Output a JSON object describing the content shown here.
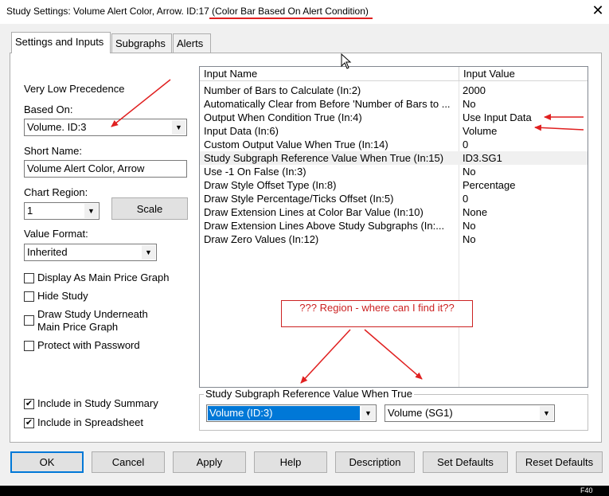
{
  "window": {
    "title_prefix": "Study Settings: Volume Alert Color, Arrow. ID:17 ",
    "title_highlight": "(Color Bar Based On Alert Condition)",
    "close_label": "✕"
  },
  "tabs": [
    {
      "label": "Settings and Inputs",
      "active": true
    },
    {
      "label": "Subgraphs",
      "active": false
    },
    {
      "label": "Alerts",
      "active": false
    }
  ],
  "settings": {
    "precedence": "Very Low Precedence",
    "based_on_label": "Based On:",
    "based_on_value": "Volume. ID:3",
    "short_name_label": "Short Name:",
    "short_name_value": "Volume Alert Color, Arrow",
    "chart_region_label": "Chart Region:",
    "chart_region_value": "1",
    "scale_button": "Scale",
    "value_format_label": "Value Format:",
    "value_format_value": "Inherited",
    "checkboxes": [
      {
        "label": "Display As Main Price Graph",
        "checked": false
      },
      {
        "label": "Hide Study",
        "checked": false
      },
      {
        "label": "Draw Study Underneath Main Price Graph",
        "checked": false
      },
      {
        "label": "Protect with Password",
        "checked": false
      }
    ],
    "draw_underneath_line1": "Draw Study Underneath",
    "draw_underneath_line2": "Main Price Graph",
    "bottom_checkboxes": [
      {
        "label": "Include in Study Summary",
        "checked": true
      },
      {
        "label": "Include in Spreadsheet",
        "checked": true
      }
    ]
  },
  "inputs_grid": {
    "columns": [
      "Input Name",
      "Input Value"
    ],
    "rows": [
      {
        "name": "Number of Bars to Calculate   (In:2)",
        "value": "2000"
      },
      {
        "name": "Automatically Clear from Before 'Number of Bars to ...",
        "value": "No"
      },
      {
        "name": "Output When Condition True   (In:4)",
        "value": "Use Input Data"
      },
      {
        "name": "Input Data   (In:6)",
        "value": "Volume"
      },
      {
        "name": "Custom Output Value When True   (In:14)",
        "value": "0"
      },
      {
        "name": "Study Subgraph Reference Value When True   (In:15)",
        "value": "ID3.SG1"
      },
      {
        "name": "Use -1 On False   (In:3)",
        "value": "No"
      },
      {
        "name": "Draw Style Offset Type   (In:8)",
        "value": "Percentage"
      },
      {
        "name": "Draw Style Percentage/Ticks Offset   (In:5)",
        "value": "0"
      },
      {
        "name": "Draw Extension Lines at Color Bar Value   (In:10)",
        "value": "None"
      },
      {
        "name": "Draw Extension Lines Above Study Subgraphs   (In:...",
        "value": "No"
      },
      {
        "name": "Draw Zero Values   (In:12)",
        "value": "No"
      }
    ],
    "selected_row": 5
  },
  "subgraph_ref": {
    "group_title": "Study Subgraph Reference Value When True",
    "study_value": "Volume (ID:3)",
    "subgraph_value": "Volume (SG1)"
  },
  "annotation": {
    "text": "??? Region - where can I find it??"
  },
  "buttons": {
    "ok": "OK",
    "cancel": "Cancel",
    "apply": "Apply",
    "help": "Help",
    "description": "Description",
    "set_defaults": "Set Defaults",
    "reset_defaults": "Reset Defaults"
  },
  "taskbar_hint": "F40",
  "colors": {
    "annotation_red": "#e02020",
    "selection_blue": "#0078d7"
  }
}
